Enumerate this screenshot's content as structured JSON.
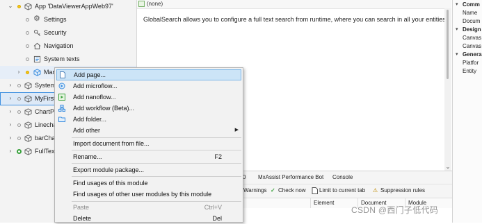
{
  "tree": {
    "app_label": "App 'DataViewerAppWeb97'",
    "settings": "Settings",
    "security": "Security",
    "navigation": "Navigation",
    "system_texts": "System texts",
    "marketplace": "Mar",
    "system": "System",
    "myfirst": "MyFirstM",
    "chartpro": "ChartPro",
    "linechart": "Linecha",
    "barchart": "barChar",
    "fulltext": "FullTextS"
  },
  "editor": {
    "header": "(none)",
    "body_text": "GlobalSearch allows you to configure a full text search from runtime, where you can search in all your entities/"
  },
  "properties": {
    "items": [
      {
        "chev": "▾",
        "text": "Comm",
        "bold": true
      },
      {
        "chev": "",
        "text": "Name",
        "bold": false
      },
      {
        "chev": "",
        "text": "Docum",
        "bold": false
      },
      {
        "chev": "▾",
        "text": "Design",
        "bold": true
      },
      {
        "chev": "",
        "text": "Canvas",
        "bold": false
      },
      {
        "chev": "",
        "text": "Canvas",
        "bold": false
      },
      {
        "chev": "▾",
        "text": "Genera",
        "bold": true
      },
      {
        "chev": "",
        "text": "Platfor",
        "bold": false
      },
      {
        "chev": "",
        "text": "Entity",
        "bold": false
      }
    ]
  },
  "bottom_panel": {
    "tab_count": "0",
    "tab_performance": "MxAssist Performance Bot",
    "tab_console": "Console",
    "warnings": "Warnings",
    "check_now": "Check now",
    "limit_tab": "Limit to current tab",
    "suppression": "Suppression rules",
    "col_element": "Element",
    "col_document": "Document",
    "col_module": "Module"
  },
  "context_menu": {
    "add_page": "Add page...",
    "add_microflow": "Add microflow...",
    "add_nanoflow": "Add nanoflow...",
    "add_workflow": "Add workflow (Beta)...",
    "add_folder": "Add folder...",
    "add_other": "Add other",
    "import_doc": "Import document from file...",
    "rename": "Rename...",
    "rename_shortcut": "F2",
    "export_pkg": "Export module package...",
    "find_usages": "Find usages of this module",
    "find_usages_other": "Find usages of other user modules by this module",
    "paste": "Paste",
    "paste_shortcut": "Ctrl+V",
    "delete": "Delete",
    "delete_shortcut": "Del"
  },
  "watermark": "CSDN @西门子低代码",
  "colors": {
    "accent": "#3b8ee0",
    "highlight": "#cce4f7",
    "status_green": "#39a13c",
    "module_yellow": "#f5c518"
  }
}
